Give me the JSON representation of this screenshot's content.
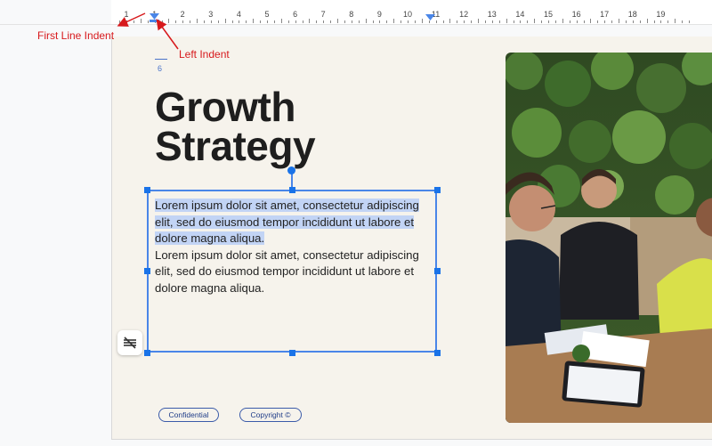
{
  "ruler": {
    "labels": [
      "1",
      "1",
      "2",
      "3",
      "4",
      "5",
      "6",
      "7",
      "8",
      "9",
      "10",
      "11",
      "12",
      "13",
      "14",
      "15",
      "16",
      "17",
      "18",
      "19"
    ]
  },
  "annotations": {
    "first_line_indent": "First Line Indent",
    "left_indent": "Left Indent"
  },
  "slide": {
    "page_number": "6",
    "title_line1": "Growth",
    "title_line2": "Strategy",
    "selected_paragraph": "Lorem ipsum dolor sit amet, consectetur adipiscing elit, sed do eiusmod tempor incididunt ut labore et dolore magna aliqua.",
    "paragraph": "Lorem ipsum dolor sit amet, consectetur adipiscing elit, sed do eiusmod tempor incididunt ut labore et dolore magna aliqua.",
    "footer_left": "Confidential",
    "footer_right": "Copyright ©"
  },
  "colors": {
    "accent": "#1a73e8",
    "annotation": "#d7191c",
    "slide_bg": "#f6f3ec",
    "selection": "#c2d4f5"
  },
  "icons": {
    "side_button": "strikethrough-align-icon",
    "first_line_marker": "triangle-down-icon",
    "tab_marker": "triangle-down-icon"
  }
}
